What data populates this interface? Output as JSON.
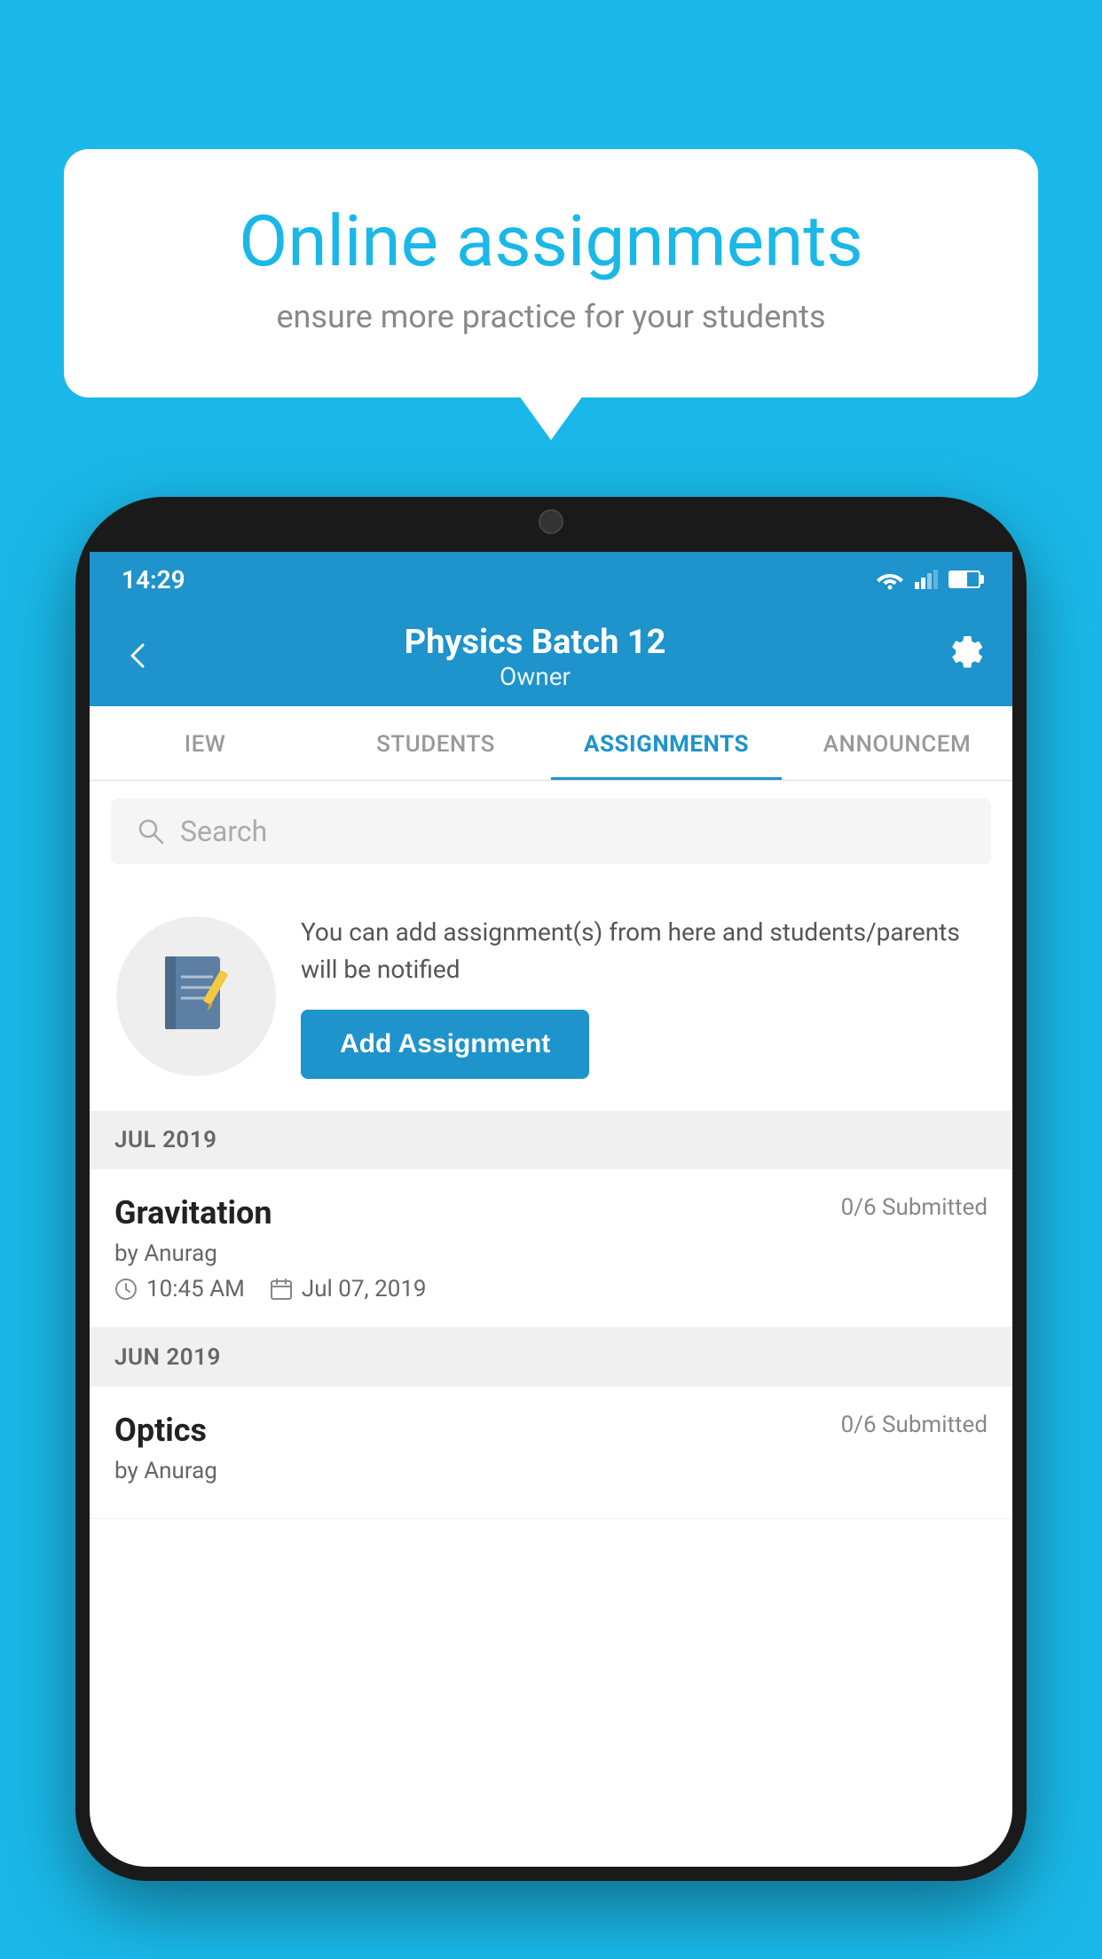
{
  "background_color": "#1ab8e8",
  "speech_bubble": {
    "title": "Online assignments",
    "subtitle": "ensure more practice for your students"
  },
  "status_bar": {
    "time": "14:29"
  },
  "app_bar": {
    "title": "Physics Batch 12",
    "subtitle": "Owner"
  },
  "tabs": [
    {
      "label": "IEW",
      "active": false
    },
    {
      "label": "STUDENTS",
      "active": false
    },
    {
      "label": "ASSIGNMENTS",
      "active": true
    },
    {
      "label": "ANNOUNCEM",
      "active": false
    }
  ],
  "search": {
    "placeholder": "Search"
  },
  "promo": {
    "description": "You can add assignment(s) from here and students/parents will be notified",
    "button_label": "Add Assignment"
  },
  "sections": [
    {
      "header": "JUL 2019",
      "assignments": [
        {
          "title": "Gravitation",
          "submitted": "0/6 Submitted",
          "by": "by Anurag",
          "time": "10:45 AM",
          "date": "Jul 07, 2019"
        }
      ]
    },
    {
      "header": "JUN 2019",
      "assignments": [
        {
          "title": "Optics",
          "submitted": "0/6 Submitted",
          "by": "by Anurag",
          "time": "",
          "date": ""
        }
      ]
    }
  ]
}
